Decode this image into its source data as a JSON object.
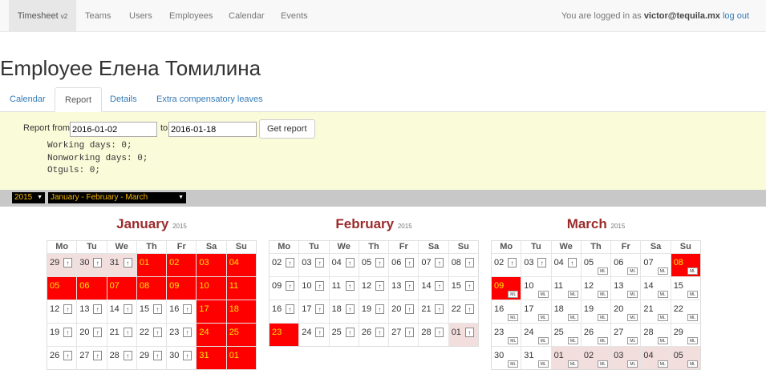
{
  "nav": {
    "brand": "Timesheet",
    "brand_version": "v2",
    "items": [
      "Teams",
      "Users",
      "Employees",
      "Calendar",
      "Events"
    ],
    "login_prefix": "You are logged in as",
    "login_user": "victor@tequila.mx",
    "logout": "log out"
  },
  "page_title": "Employee Елена Томилина",
  "tabs": [
    "Calendar",
    "Report",
    "Details",
    "Extra compensatory leaves"
  ],
  "report": {
    "from_label": "Report from",
    "from_value": "2016-01-02",
    "to_label": "to",
    "to_value": "2016-01-18",
    "button": "Get report",
    "working_days": "Working days: 0;",
    "nonworking_days": "Nonworking days: 0;",
    "otguls": "Otguls: 0;"
  },
  "selectors": {
    "year": "2015",
    "period": "January - February - March"
  },
  "colors": {
    "holiday": "#ff0000",
    "holiday_text": "#ffe600",
    "other_month": "#f3dede",
    "month_title": "#9c2b2b"
  },
  "weekdays": [
    "Mo",
    "Tu",
    "We",
    "Th",
    "Fr",
    "Sa",
    "Su"
  ],
  "up_icon": "↑",
  "ml_label": "ML",
  "months": [
    {
      "name": "January",
      "year": "2015",
      "weeks": [
        [
          {
            "d": "29",
            "s": "pink",
            "up": true
          },
          {
            "d": "30",
            "s": "pink",
            "up": true
          },
          {
            "d": "31",
            "s": "pink",
            "up": true
          },
          {
            "d": "01",
            "s": "red"
          },
          {
            "d": "02",
            "s": "red"
          },
          {
            "d": "03",
            "s": "red"
          },
          {
            "d": "04",
            "s": "red"
          }
        ],
        [
          {
            "d": "05",
            "s": "red"
          },
          {
            "d": "06",
            "s": "red"
          },
          {
            "d": "07",
            "s": "red"
          },
          {
            "d": "08",
            "s": "red"
          },
          {
            "d": "09",
            "s": "red"
          },
          {
            "d": "10",
            "s": "red"
          },
          {
            "d": "11",
            "s": "red"
          }
        ],
        [
          {
            "d": "12",
            "up": true
          },
          {
            "d": "13",
            "up": true
          },
          {
            "d": "14",
            "up": true
          },
          {
            "d": "15",
            "up": true
          },
          {
            "d": "16",
            "up": true
          },
          {
            "d": "17",
            "s": "red"
          },
          {
            "d": "18",
            "s": "red"
          }
        ],
        [
          {
            "d": "19",
            "up": true
          },
          {
            "d": "20",
            "up": true
          },
          {
            "d": "21",
            "up": true
          },
          {
            "d": "22",
            "up": true
          },
          {
            "d": "23",
            "up": true
          },
          {
            "d": "24",
            "s": "red"
          },
          {
            "d": "25",
            "s": "red"
          }
        ],
        [
          {
            "d": "26",
            "up": true
          },
          {
            "d": "27",
            "up": true
          },
          {
            "d": "28",
            "up": true
          },
          {
            "d": "29",
            "up": true
          },
          {
            "d": "30",
            "up": true
          },
          {
            "d": "31",
            "s": "red"
          },
          {
            "d": "01",
            "s": "red"
          }
        ]
      ]
    },
    {
      "name": "February",
      "year": "2015",
      "weeks": [
        [
          {
            "d": "02",
            "up": true
          },
          {
            "d": "03",
            "up": true
          },
          {
            "d": "04",
            "up": true
          },
          {
            "d": "05",
            "up": true
          },
          {
            "d": "06",
            "up": true
          },
          {
            "d": "07",
            "up": true
          },
          {
            "d": "08",
            "up": true
          }
        ],
        [
          {
            "d": "09",
            "up": true
          },
          {
            "d": "10",
            "up": true
          },
          {
            "d": "11",
            "up": true
          },
          {
            "d": "12",
            "up": true
          },
          {
            "d": "13",
            "up": true
          },
          {
            "d": "14",
            "up": true
          },
          {
            "d": "15",
            "up": true
          }
        ],
        [
          {
            "d": "16",
            "up": true
          },
          {
            "d": "17",
            "up": true
          },
          {
            "d": "18",
            "up": true
          },
          {
            "d": "19",
            "up": true
          },
          {
            "d": "20",
            "up": true
          },
          {
            "d": "21",
            "up": true
          },
          {
            "d": "22",
            "up": true
          }
        ],
        [
          {
            "d": "23",
            "s": "red"
          },
          {
            "d": "24",
            "up": true
          },
          {
            "d": "25",
            "up": true
          },
          {
            "d": "26",
            "up": true
          },
          {
            "d": "27",
            "up": true
          },
          {
            "d": "28",
            "up": true
          },
          {
            "d": "01",
            "s": "pink",
            "up": true
          }
        ]
      ]
    },
    {
      "name": "March",
      "year": "2015",
      "weeks": [
        [
          {
            "d": "02",
            "up": true
          },
          {
            "d": "03",
            "up": true
          },
          {
            "d": "04",
            "up": true
          },
          {
            "d": "05",
            "ml": true
          },
          {
            "d": "06",
            "ml": true
          },
          {
            "d": "07",
            "ml": true
          },
          {
            "d": "08",
            "s": "red",
            "ml": true
          }
        ],
        [
          {
            "d": "09",
            "s": "red",
            "ml": true
          },
          {
            "d": "10",
            "ml": true
          },
          {
            "d": "11",
            "ml": true
          },
          {
            "d": "12",
            "ml": true
          },
          {
            "d": "13",
            "ml": true
          },
          {
            "d": "14",
            "ml": true
          },
          {
            "d": "15",
            "ml": true
          }
        ],
        [
          {
            "d": "16",
            "ml": true
          },
          {
            "d": "17",
            "ml": true
          },
          {
            "d": "18",
            "ml": true
          },
          {
            "d": "19",
            "ml": true
          },
          {
            "d": "20",
            "ml": true
          },
          {
            "d": "21",
            "ml": true
          },
          {
            "d": "22",
            "ml": true
          }
        ],
        [
          {
            "d": "23",
            "ml": true
          },
          {
            "d": "24",
            "ml": true
          },
          {
            "d": "25",
            "ml": true
          },
          {
            "d": "26",
            "ml": true
          },
          {
            "d": "27",
            "ml": true
          },
          {
            "d": "28",
            "ml": true
          },
          {
            "d": "29",
            "ml": true
          }
        ],
        [
          {
            "d": "30",
            "ml": true
          },
          {
            "d": "31",
            "ml": true
          },
          {
            "d": "01",
            "s": "pink",
            "ml": true
          },
          {
            "d": "02",
            "s": "pink",
            "ml": true
          },
          {
            "d": "03",
            "s": "pink",
            "ml": true
          },
          {
            "d": "04",
            "s": "pink",
            "ml": true
          },
          {
            "d": "05",
            "s": "pink",
            "ml": true
          }
        ]
      ]
    }
  ]
}
